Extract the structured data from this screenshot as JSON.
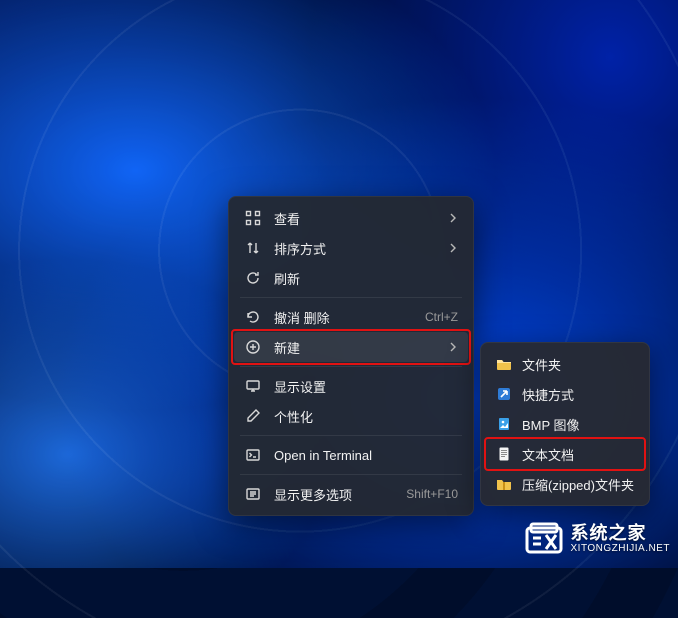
{
  "contextMenu": {
    "items": [
      {
        "id": "view",
        "label": "查看",
        "icon": "view-icon",
        "hasSubmenu": true,
        "shortcut": ""
      },
      {
        "id": "sort",
        "label": "排序方式",
        "icon": "sort-icon",
        "hasSubmenu": true,
        "shortcut": ""
      },
      {
        "id": "refresh",
        "label": "刷新",
        "icon": "refresh-icon",
        "hasSubmenu": false,
        "shortcut": ""
      },
      {
        "sep": true
      },
      {
        "id": "undo-delete",
        "label": "撤消 删除",
        "icon": "undo-icon",
        "hasSubmenu": false,
        "shortcut": "Ctrl+Z"
      },
      {
        "id": "new",
        "label": "新建",
        "icon": "new-icon",
        "hasSubmenu": true,
        "shortcut": "",
        "active": true
      },
      {
        "sep": true
      },
      {
        "id": "display",
        "label": "显示设置",
        "icon": "display-icon",
        "hasSubmenu": false,
        "shortcut": ""
      },
      {
        "id": "personalize",
        "label": "个性化",
        "icon": "personalize-icon",
        "hasSubmenu": false,
        "shortcut": ""
      },
      {
        "sep": true
      },
      {
        "id": "terminal",
        "label": "Open in Terminal",
        "icon": "terminal-icon",
        "hasSubmenu": false,
        "shortcut": ""
      },
      {
        "sep": true
      },
      {
        "id": "more",
        "label": "显示更多选项",
        "icon": "more-icon",
        "hasSubmenu": false,
        "shortcut": "Shift+F10"
      }
    ]
  },
  "submenu": {
    "items": [
      {
        "id": "folder",
        "label": "文件夹",
        "icon": "folder-icon"
      },
      {
        "id": "shortcut",
        "label": "快捷方式",
        "icon": "shortcut-icon"
      },
      {
        "id": "bmp",
        "label": "BMP 图像",
        "icon": "bmp-icon"
      },
      {
        "id": "text",
        "label": "文本文档",
        "icon": "text-icon",
        "highlighted": true
      },
      {
        "id": "zip",
        "label": "压缩(zipped)文件夹",
        "icon": "zip-icon"
      }
    ]
  },
  "watermark": {
    "title": "系统之家",
    "url": "XITONGZHIJIA.NET"
  }
}
